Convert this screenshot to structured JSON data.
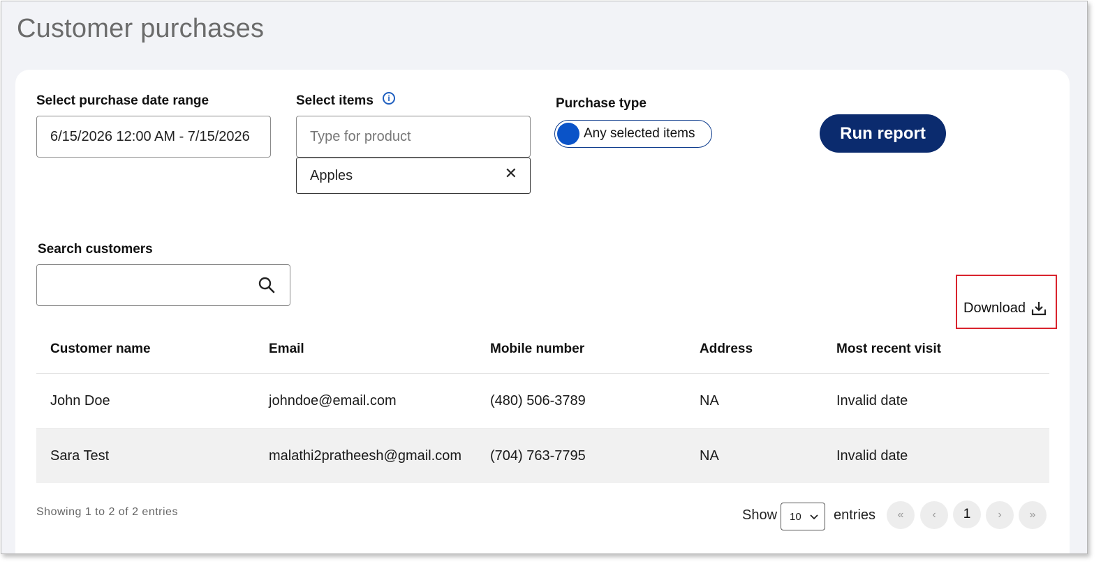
{
  "page": {
    "title": "Customer purchases"
  },
  "filters": {
    "date_range": {
      "label": "Select purchase date range",
      "value": "6/15/2026 12:00 AM - 7/15/2026"
    },
    "items": {
      "label": "Select items",
      "placeholder": "Type for product",
      "selected": [
        "Apples"
      ]
    },
    "purchase_type": {
      "label": "Purchase type",
      "value": "Any selected items"
    },
    "run_button": "Run report"
  },
  "search": {
    "label": "Search customers",
    "value": ""
  },
  "download": {
    "label": "Download"
  },
  "table": {
    "headers": [
      "Customer name",
      "Email",
      "Mobile number",
      "Address",
      "Most recent visit"
    ],
    "rows": [
      [
        "John Doe",
        "johndoe@email.com",
        "(480) 506-3789",
        "NA",
        "Invalid date"
      ],
      [
        "Sara Test",
        "malathi2pratheesh@gmail.com",
        "(704) 763-7795",
        "NA",
        "Invalid date"
      ]
    ]
  },
  "footer": {
    "showing": "Showing 1 to 2 of 2 entries",
    "show_label": "Show",
    "page_size": "10",
    "entries_label": "entries",
    "pagination": {
      "first": "«",
      "prev": "‹",
      "current": "1",
      "next": "›",
      "last": "»"
    }
  },
  "colors": {
    "accent": "#0b2b6e",
    "toggle": "#0a53c8",
    "highlight": "#d9232d"
  }
}
